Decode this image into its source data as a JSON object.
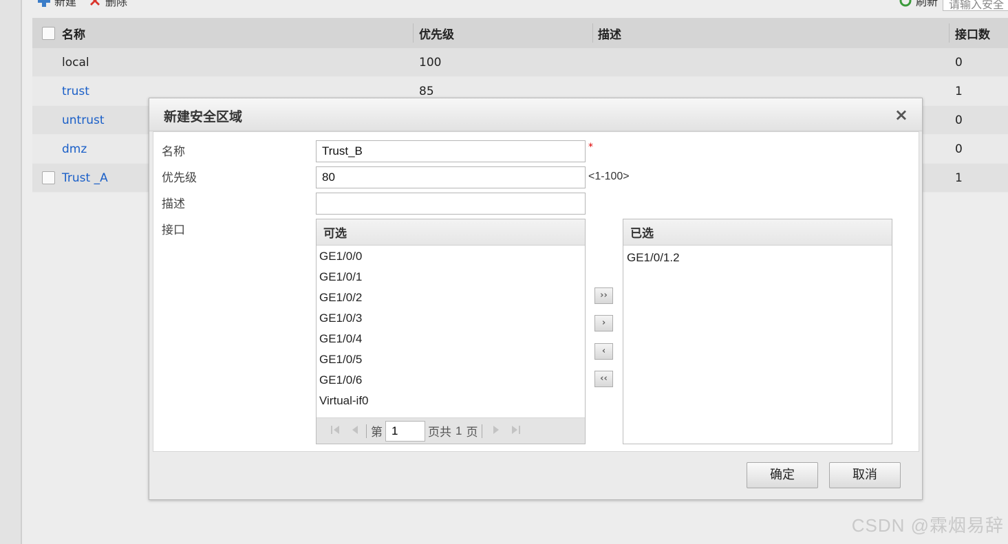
{
  "toolbar": {
    "new_label": "新建",
    "delete_label": "删除",
    "refresh_label": "刷新",
    "search_placeholder": "请输入安全"
  },
  "grid": {
    "headers": {
      "name": "名称",
      "priority": "优先级",
      "description": "描述",
      "iface_count": "接口数"
    },
    "rows": [
      {
        "name": "local",
        "priority": "100",
        "description": "",
        "iface_count": "0"
      },
      {
        "name": "trust",
        "priority": "85",
        "description": "",
        "iface_count": "1"
      },
      {
        "name": "untrust",
        "priority": "",
        "description": "",
        "iface_count": "0"
      },
      {
        "name": "dmz",
        "priority": "",
        "description": "",
        "iface_count": "0"
      },
      {
        "name": "Trust _A",
        "priority": "",
        "description": "",
        "iface_count": "1"
      }
    ]
  },
  "dialog": {
    "title": "新建安全区域",
    "close_glyph": "×",
    "labels": {
      "name": "名称",
      "priority": "优先级",
      "description": "描述",
      "interface": "接口"
    },
    "name_value": "Trust_B",
    "required_mark": "*",
    "priority_value": "80",
    "priority_hint": "<1-100>",
    "description_value": "",
    "available": {
      "header": "可选",
      "items": [
        "GE1/0/0",
        "GE1/0/1",
        "GE1/0/2",
        "GE1/0/3",
        "GE1/0/4",
        "GE1/0/5",
        "GE1/0/6",
        "Virtual-if0"
      ]
    },
    "selected": {
      "header": "已选",
      "items": [
        "GE1/0/1.2"
      ]
    },
    "pager": {
      "prefix": "第",
      "page": "1",
      "middle": "页共",
      "total": "1",
      "suffix": "页"
    },
    "move_buttons": {
      "add_all": "››",
      "add": "›",
      "remove": "‹",
      "remove_all": "‹‹"
    },
    "ok_label": "确定",
    "cancel_label": "取消"
  },
  "watermark": "CSDN @霖烟易辞",
  "colors": {
    "link": "#1a5fc8",
    "required": "#dd0000"
  }
}
